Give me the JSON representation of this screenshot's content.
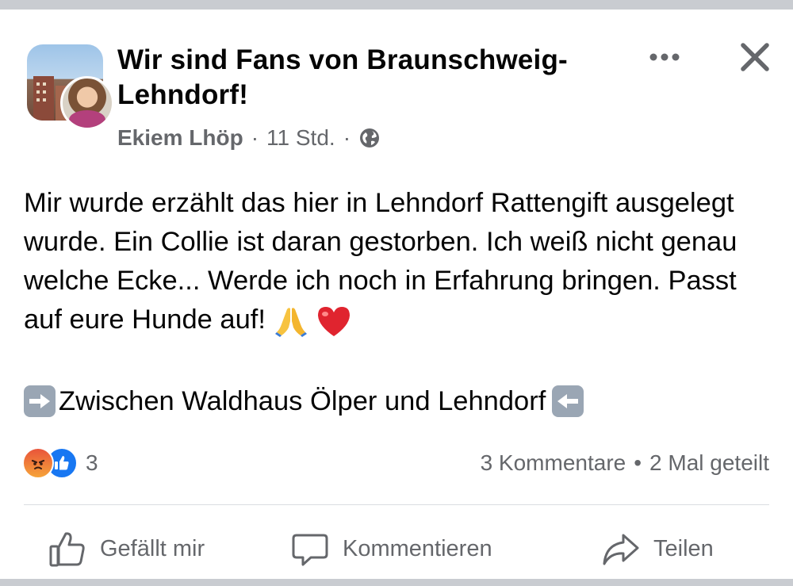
{
  "header": {
    "group_name": "Wir sind Fans von Braunschweig-Lehndorf!",
    "author": "Ekiem Lhöp",
    "separator": "·",
    "time": "11 Std.",
    "privacy_icon": "globe-icon",
    "more_icon": "more-dots-icon",
    "close_icon": "close-icon"
  },
  "post": {
    "paragraph": "Mir wurde erzählt das hier in Lehndorf Rattengift ausgelegt wurde. Ein Collie ist daran gestorben. Ich weiß nicht genau welche Ecke... Werde ich noch in Erfahrung bringen. Passt auf eure Hunde auf!",
    "emojis": [
      "folded-hands-emoji",
      "red-heart-emoji"
    ],
    "location_line": "Zwischen Waldhaus Ölper und Lehndorf",
    "location_prefix_icon": "right-arrow-emoji",
    "location_suffix_icon": "left-arrow-emoji"
  },
  "engagement": {
    "reaction_icons": [
      "angry-reaction-icon",
      "like-reaction-icon"
    ],
    "reaction_count": "3",
    "comments": "3 Kommentare",
    "bullet": "•",
    "shares": "2 Mal geteilt"
  },
  "actions": {
    "like_label": "Gefällt mir",
    "comment_label": "Kommentieren",
    "share_label": "Teilen"
  },
  "colors": {
    "text": "#050505",
    "secondary_text": "#65676b",
    "like_blue": "#1877f2",
    "divider": "#dadde1",
    "background": "#ffffff"
  }
}
